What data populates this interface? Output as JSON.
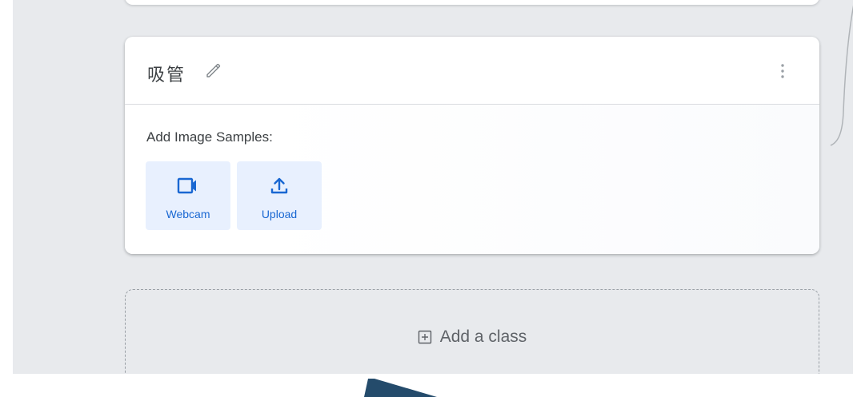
{
  "class_card": {
    "name": "吸管",
    "samples_label": "Add Image Samples:",
    "buttons": [
      {
        "label": "Webcam",
        "icon": "video-camera-icon"
      },
      {
        "label": "Upload",
        "icon": "upload-icon"
      }
    ]
  },
  "add_class": {
    "label": "Add a class",
    "icon": "plus-box-icon"
  },
  "colors": {
    "canvas": "#e8eaed",
    "accent": "#1967d2",
    "button_bg": "#e8f0fe",
    "arrow": "#244b6b"
  }
}
